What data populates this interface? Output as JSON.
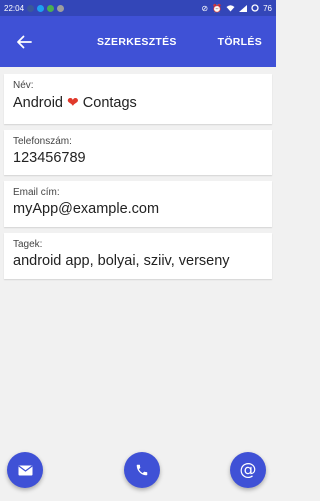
{
  "status_bar": {
    "time": "22:04",
    "battery": "76"
  },
  "app_bar": {
    "title": "SZERKESZTÉS",
    "action": "TÖRLÉS"
  },
  "fields": [
    {
      "label": "Név:",
      "value_before_heart": "Android",
      "value_after_heart": "Contags"
    },
    {
      "label": "Telefonszám:",
      "value": "123456789"
    },
    {
      "label": "Email cím:",
      "value": "myApp@example.com"
    },
    {
      "label": "Tagek:",
      "value": "android app, bolyai, sziiv, verseny"
    }
  ],
  "fab_buttons": [
    {
      "icon": "email-icon"
    },
    {
      "icon": "phone-icon"
    },
    {
      "icon": "at-sign-icon",
      "glyph": "@"
    }
  ],
  "colors": {
    "primary": "#3f51d6",
    "status_bar": "#3346b8",
    "heart": "#e0392b",
    "background": "#f1f1f1"
  }
}
